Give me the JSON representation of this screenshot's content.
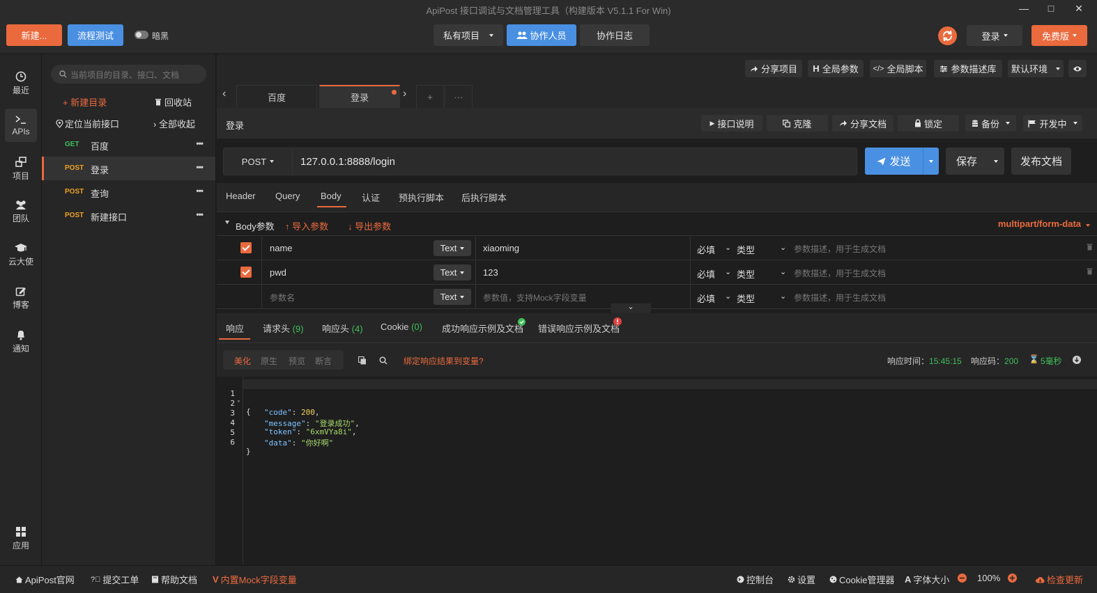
{
  "window": {
    "title": "ApiPost 接口调试与文档管理工具（构建版本 V5.1.1 For Win)",
    "minimize": "—",
    "maximize": "□",
    "close": "✕"
  },
  "toolbar": {
    "new_label": "新建...",
    "flow_test_label": "流程测试",
    "dark_label": "暗黑",
    "project_scope": "私有项目",
    "collaborators": "协作人员",
    "collab_log": "协作日志",
    "login": "登录",
    "free_edition": "免费版"
  },
  "rail": {
    "items": [
      {
        "label": "最近",
        "icon": "clock-icon"
      },
      {
        "label": "APIs",
        "icon": "terminal-icon"
      },
      {
        "label": "项目",
        "icon": "project-icon"
      },
      {
        "label": "团队",
        "icon": "team-icon"
      },
      {
        "label": "云大使",
        "icon": "graduation-cap-icon"
      },
      {
        "label": "博客",
        "icon": "edit-icon"
      },
      {
        "label": "通知",
        "icon": "bell-icon"
      },
      {
        "label": "应用",
        "icon": "grid-icon"
      }
    ]
  },
  "tree": {
    "search_placeholder": "当前项目的目录、接口、文档",
    "new_dir": "新建目录",
    "recycle": "回收站",
    "locate": "定位当前接口",
    "collapse_all": "全部收起",
    "items": [
      {
        "method": "GET",
        "name": "百度",
        "method_color": "#3fbf5a"
      },
      {
        "method": "POST",
        "name": "登录",
        "method_color": "#f0a020"
      },
      {
        "method": "POST",
        "name": "查询",
        "method_color": "#f0a020"
      },
      {
        "method": "POST",
        "name": "新建接口",
        "method_color": "#f0a020"
      }
    ],
    "more": "•••"
  },
  "project_tools": {
    "share_project": "分享项目",
    "global_params": "全局参数",
    "global_script": "全局脚本",
    "param_desc_lib": "参数描述库",
    "env": "默认环境",
    "eye": "eye-icon"
  },
  "tabs": {
    "items": [
      "百度",
      "登录"
    ],
    "add": "+",
    "more": "···",
    "prev": "‹",
    "next": "›"
  },
  "request": {
    "name": "登录",
    "doc_btn": "接口说明",
    "clone": "克隆",
    "share_doc": "分享文档",
    "lock": "锁定",
    "backup": "备份",
    "status": "开发中",
    "method": "POST",
    "url": "127.0.0.1:8888/login",
    "send": "发送",
    "save": "保存",
    "publish": "发布文档"
  },
  "subtabs": {
    "items": [
      "Header",
      "Query",
      "Body",
      "认证",
      "预执行脚本",
      "后执行脚本"
    ],
    "active": "Body"
  },
  "body": {
    "section_label": "Body参数",
    "import": "导入参数",
    "export": "导出参数",
    "content_type": "multipart/form-data",
    "type_label": "Text",
    "required_label": "必填",
    "kind_label": "类型",
    "desc_placeholder": "参数描述，用于生成文档",
    "name_placeholder": "参数名",
    "value_placeholder": "参数值，支持Mock字段变量",
    "params": [
      {
        "name": "name",
        "value": "xiaoming"
      },
      {
        "name": "pwd",
        "value": "123"
      }
    ]
  },
  "response": {
    "tabs": [
      {
        "label": "响应",
        "count": ""
      },
      {
        "label": "请求头",
        "count": "(9)"
      },
      {
        "label": "响应头",
        "count": "(4)"
      },
      {
        "label": "Cookie",
        "count": "(0)"
      },
      {
        "label": "成功响应示例及文档",
        "count": ""
      },
      {
        "label": "错误响应示例及文档",
        "count": ""
      }
    ],
    "view_modes": [
      "美化",
      "原生",
      "预览",
      "断言"
    ],
    "bind_label": "绑定响应结果到变量?",
    "time_label": "响应时间：",
    "time_value": "15:45:15",
    "code_label": "响应码：",
    "code_value": "200",
    "duration": "5毫秒",
    "lines": [
      {
        "n": "1",
        "text": "{"
      },
      {
        "n": "2",
        "key": "\"code\"",
        "val": "200",
        "type": "num",
        "comma": ","
      },
      {
        "n": "3",
        "key": "\"message\"",
        "val": "\"登录成功\"",
        "type": "str",
        "comma": ","
      },
      {
        "n": "4",
        "key": "\"token\"",
        "val": "\"6xmVYa8i\"",
        "type": "str",
        "comma": ","
      },
      {
        "n": "5",
        "key": "\"data\"",
        "val": "\"你好啊\"",
        "type": "str",
        "comma": ""
      },
      {
        "n": "6",
        "text": "}"
      }
    ]
  },
  "footer": {
    "official": "ApiPost官网",
    "ticket": "提交工单",
    "help": "帮助文档",
    "mock": "内置Mock字段变量",
    "console": "控制台",
    "settings": "设置",
    "cookie_mgr": "Cookie管理器",
    "font_size": "字体大小",
    "zoom": "100%",
    "update": "检查更新"
  },
  "colors": {
    "accent_orange": "#ea6a3e",
    "accent_blue": "#4a90e2",
    "get_green": "#3fbf5a",
    "post_orange": "#f0a020"
  }
}
